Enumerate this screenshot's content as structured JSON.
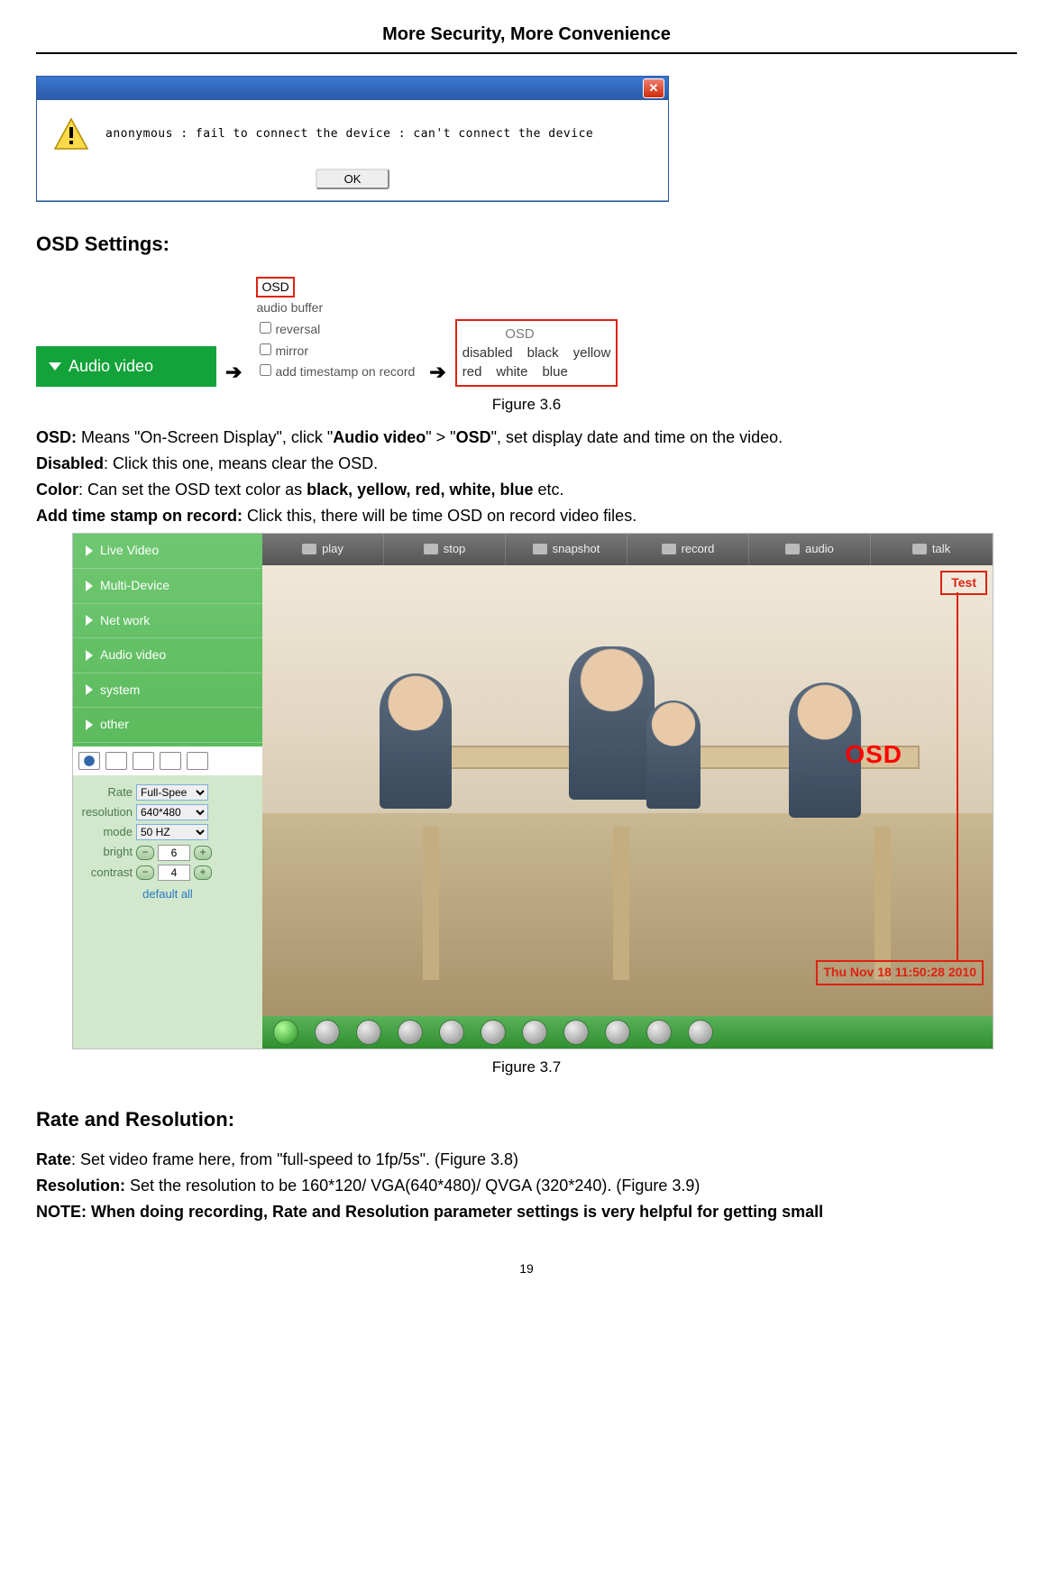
{
  "header": {
    "title": "More Security, More Convenience"
  },
  "dialog": {
    "message": "anonymous : fail to connect the device : can't connect the device",
    "ok": "OK"
  },
  "osd_settings": {
    "heading": "OSD Settings",
    "button_label": "Audio video",
    "list1": {
      "osd": "OSD",
      "audio_buffer": "audio buffer",
      "reversal": "reversal",
      "mirror": "mirror",
      "add_ts": "add timestamp on record"
    },
    "list2": {
      "label": "OSD",
      "row1": [
        "disabled",
        "black",
        "yellow"
      ],
      "row2": [
        "red",
        "white",
        "blue"
      ]
    },
    "fig_caption": "Figure 3.6",
    "para": {
      "l1a": "OSD:",
      "l1b": " Means \"On-Screen Display\", click \"",
      "l1c": "Audio video",
      "l1d": "\" > \"",
      "l1e": "OSD",
      "l1f": "\", set display date and time on the video.",
      "l2a": "Disabled",
      "l2b": ": Click this one, means clear the OSD.",
      "l3a": "Color",
      "l3b": ": Can set the OSD text color as ",
      "l3c": "black, yellow, red, white, blue",
      "l3d": " etc.",
      "l4a": "Add time stamp on record:",
      "l4b": " Click this, there will be time OSD on record video files."
    }
  },
  "cam_ui": {
    "sidebar": {
      "nav": [
        "Live Video",
        "Multi-Device",
        "Net work",
        "Audio video",
        "system",
        "other"
      ],
      "settings": {
        "rate_label": "Rate",
        "rate_value": "Full-Spee",
        "resolution_label": "resolution",
        "resolution_value": "640*480",
        "mode_label": "mode",
        "mode_value": "50 HZ",
        "bright_label": "bright",
        "bright_value": "6",
        "contrast_label": "contrast",
        "contrast_value": "4",
        "default_all": "default all"
      }
    },
    "toolbar": [
      "play",
      "stop",
      "snapshot",
      "record",
      "audio",
      "talk"
    ],
    "video": {
      "test_label": "Test",
      "osd_big": "OSD",
      "timestamp": "Thu Nov 18 11:50:28 2010"
    },
    "fig_caption": "Figure 3.7"
  },
  "rate_res": {
    "heading": "Rate and Resolution",
    "l1a": "Rate",
    "l1b": ": Set video frame here, from \"full-speed to 1fp/5s\". (Figure 3.8)",
    "l2a": "Resolution:",
    "l2b": " Set the resolution to be 160*120/ VGA(640*480)/ QVGA (320*240). (Figure 3.9)",
    "l3": "NOTE: When doing recording, Rate and Resolution parameter settings is very helpful for getting small"
  },
  "footer": {
    "page": "19"
  }
}
